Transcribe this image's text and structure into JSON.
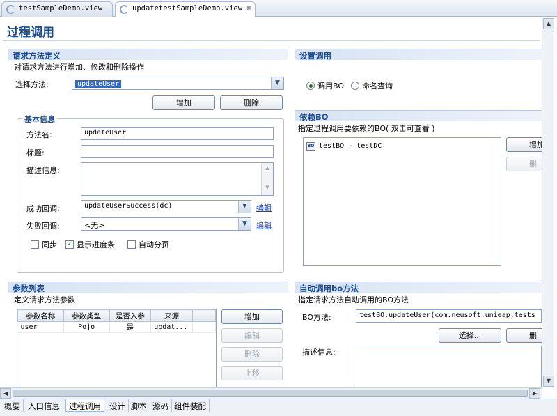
{
  "editor_tabs": [
    {
      "label": "testSampleDemo.view",
      "active": false
    },
    {
      "label": "updatetestSampleDemo.view",
      "active": true
    }
  ],
  "page": {
    "title": "过程调用"
  },
  "request_method": {
    "header": "请求方法定义",
    "description": "对请求方法进行增加、修改和删除操作",
    "select_label": "选择方法:",
    "selected_method": "updateUser",
    "add_button": "增加",
    "delete_button": "删除"
  },
  "basic_info": {
    "group_title": "基本信息",
    "method_name_label": "方法名:",
    "method_name_value": "updateUser",
    "title_label": "标题:",
    "title_value": "",
    "description_label": "描述信息:",
    "description_value": "",
    "success_label": "成功回调:",
    "success_value": "updateUserSuccess(dc)",
    "success_edit": "编辑",
    "failure_label": "失败回调:",
    "failure_value": "<无>",
    "failure_edit": "编辑",
    "checkboxes": [
      {
        "label": "同步",
        "checked": false
      },
      {
        "label": "显示进度条",
        "checked": true
      },
      {
        "label": "自动分页",
        "checked": false
      }
    ]
  },
  "params": {
    "header": "参数列表",
    "description": "定义请求方法参数",
    "columns": [
      "参数名称",
      "参数类型",
      "是否入参",
      "来源"
    ],
    "rows": [
      [
        "user",
        "Pojo",
        "是",
        "updat..."
      ]
    ],
    "buttons": {
      "add": "增加",
      "edit": "编辑",
      "delete": "删除",
      "up": "上移"
    }
  },
  "call_settings": {
    "header": "设置调用",
    "options": [
      {
        "label": "调用BO",
        "selected": true
      },
      {
        "label": "命名查询",
        "selected": false
      }
    ]
  },
  "dependent_bo": {
    "header": "依赖BO",
    "description": "指定过程调用要依赖的BO( 双击可查看 )",
    "items": [
      "testBO - testDC"
    ],
    "add_button": "增加",
    "delete_button": "删"
  },
  "auto_call": {
    "header": "自动调用bo方法",
    "description": "指定请求方法自动调用的BO方法",
    "bo_method_label": "BO方法:",
    "bo_method_value": "testBO.updateUser(com.neusoft.unieap.tests",
    "select_button": "选择...",
    "delete_button": "删",
    "description_label": "描述信息:",
    "description_value": ""
  },
  "bottom_tabs": [
    {
      "label": "概要",
      "active": false
    },
    {
      "label": "入口信息",
      "active": false
    },
    {
      "label": "过程调用",
      "active": true
    },
    {
      "label": "设计",
      "active": false
    },
    {
      "label": "脚本",
      "active": false
    },
    {
      "label": "源码",
      "active": false
    },
    {
      "label": "组件装配",
      "active": false
    }
  ],
  "colors": {
    "accent": "#1a4b8f",
    "selection": "#316ac5",
    "link": "#1a3fb5"
  }
}
